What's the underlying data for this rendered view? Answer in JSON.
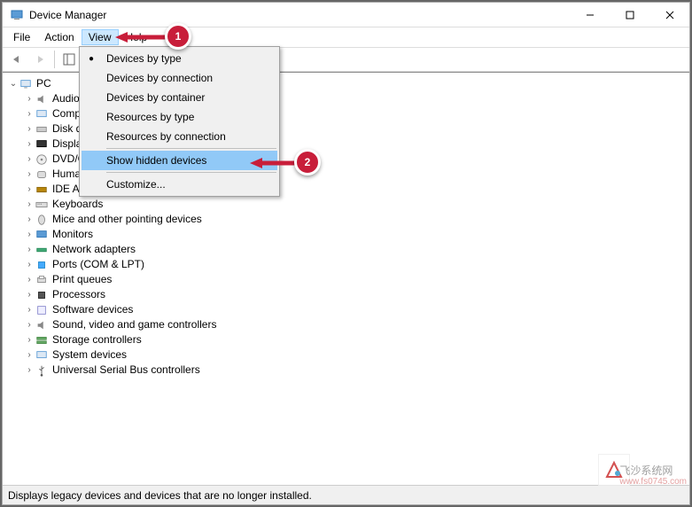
{
  "title": "Device Manager",
  "menu": {
    "file": "File",
    "action": "Action",
    "view": "View",
    "help": "Help"
  },
  "dropdown": {
    "devices_by_type": "Devices by type",
    "devices_by_connection": "Devices by connection",
    "devices_by_container": "Devices by container",
    "resources_by_type": "Resources by type",
    "resources_by_connection": "Resources by connection",
    "show_hidden": "Show hidden devices",
    "customize": "Customize..."
  },
  "tree": {
    "root": "PC",
    "items": [
      "Audio inputs and outputs",
      "Computer",
      "Disk drives",
      "Display adapters",
      "DVD/CD-ROM drives",
      "Human Interface Devices",
      "IDE ATA/ATAPI controllers",
      "Keyboards",
      "Mice and other pointing devices",
      "Monitors",
      "Network adapters",
      "Ports (COM & LPT)",
      "Print queues",
      "Processors",
      "Software devices",
      "Sound, video and game controllers",
      "Storage controllers",
      "System devices",
      "Universal Serial Bus controllers"
    ]
  },
  "statusbar": "Displays legacy devices and devices that are no longer installed.",
  "callout": {
    "one": "1",
    "two": "2"
  },
  "watermark": {
    "brand": "飞沙系统网",
    "url": "www.fs0745.com"
  }
}
